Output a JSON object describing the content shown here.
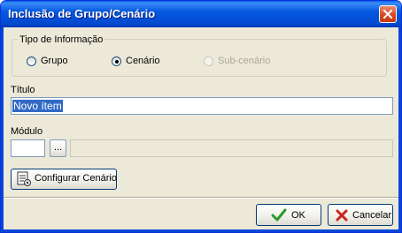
{
  "window": {
    "title": "Inclusão de Grupo/Cenário"
  },
  "tipo": {
    "legend": "Tipo de Informação",
    "options": [
      {
        "label": "Grupo",
        "checked": false,
        "disabled": false
      },
      {
        "label": "Cenário",
        "checked": true,
        "disabled": false
      },
      {
        "label": "Sub-cenário",
        "checked": false,
        "disabled": true
      }
    ]
  },
  "titulo": {
    "label": "Título",
    "value": "Novo ítem"
  },
  "modulo": {
    "label": "Módulo",
    "code": "",
    "browse_label": "...",
    "description": ""
  },
  "buttons": {
    "configurar": "Configurar Cenário",
    "ok": "OK",
    "cancelar": "Cancelar"
  },
  "colors": {
    "titlebar": "#0558e0",
    "dialog_bg": "#ece9d8",
    "selection": "#316ac5",
    "ok_check": "#2a9a2a",
    "cancel_x": "#c8261b"
  },
  "icons": {
    "close": "close-icon",
    "configure": "document-config-icon",
    "ok": "checkmark-icon",
    "cancel": "x-icon"
  }
}
